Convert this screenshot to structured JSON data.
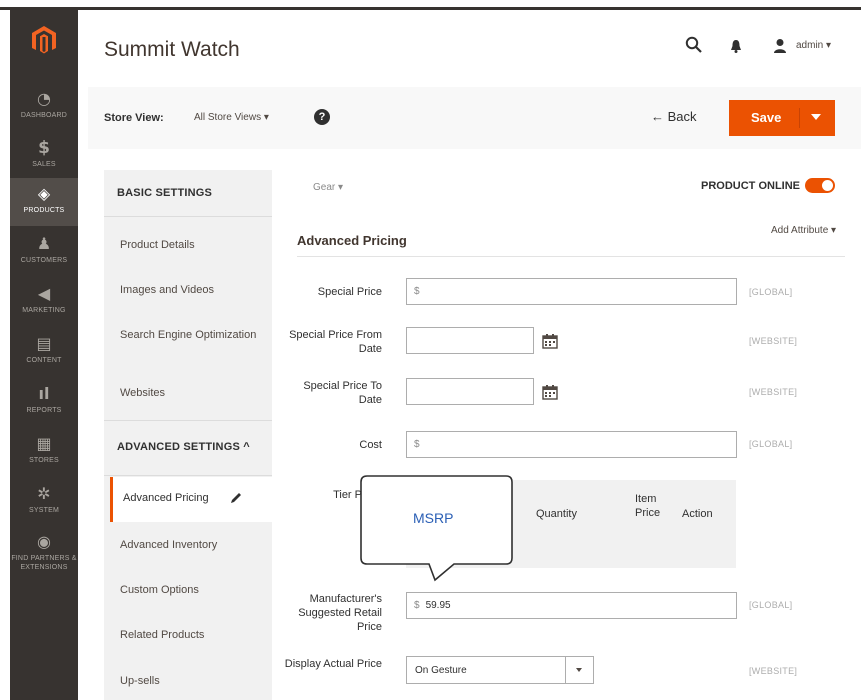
{
  "nav": {
    "items": [
      {
        "label": "DASHBOARD",
        "icon": "dashboard-icon"
      },
      {
        "label": "SALES",
        "icon": "dollar-icon"
      },
      {
        "label": "PRODUCTS",
        "icon": "cube-icon"
      },
      {
        "label": "CUSTOMERS",
        "icon": "person-icon"
      },
      {
        "label": "MARKETING",
        "icon": "megaphone-icon"
      },
      {
        "label": "CONTENT",
        "icon": "layout-icon"
      },
      {
        "label": "REPORTS",
        "icon": "bar-chart-icon"
      },
      {
        "label": "STORES",
        "icon": "store-icon"
      },
      {
        "label": "SYSTEM",
        "icon": "gear-icon"
      },
      {
        "label": "FIND PARTNERS & EXTENSIONS",
        "icon": "partners-icon"
      }
    ],
    "active": "PRODUCTS"
  },
  "header": {
    "title": "Summit Watch",
    "user": "admin ▾"
  },
  "storebar": {
    "label": "Store View:",
    "value": "All Store Views ▾",
    "help": "?",
    "back": "← Back",
    "save": "Save"
  },
  "side": {
    "basic_heading": "BASIC SETTINGS",
    "basic_items": [
      "Product Details",
      "Images and Videos",
      "Search Engine Optimization",
      "Websites"
    ],
    "advanced_heading": "ADVANCED SETTINGS  ^",
    "active_item": "Advanced Pricing",
    "advanced_items": [
      "Advanced Inventory",
      "Custom Options",
      "Related Products",
      "Up-sells"
    ]
  },
  "content": {
    "breadcrumb": "Gear ▾",
    "online_label": "PRODUCT ONLINE",
    "online": true,
    "section_title": "Advanced Pricing",
    "add_attribute": "Add Attribute ▾",
    "fields": {
      "special_price": {
        "label": "Special Price",
        "value": "$",
        "scope": "[GLOBAL]"
      },
      "special_from": {
        "label": "Special Price From Date",
        "value": "",
        "scope": "[WEBSITE]"
      },
      "special_to": {
        "label": "Special Price To Date",
        "value": "",
        "scope": "[WEBSITE]"
      },
      "cost": {
        "label": "Cost",
        "value": "$",
        "scope": "[GLOBAL]"
      },
      "tier": {
        "label": "Tier P",
        "col_quantity": "Quantity",
        "col_price": "Item Price",
        "col_action": "Action"
      },
      "msrp": {
        "label": "Manufacturer's Suggested Retail Price",
        "currency": "$",
        "value": "59.95",
        "scope": "[GLOBAL]"
      },
      "display_actual": {
        "label": "Display Actual Price",
        "value": "On Gesture",
        "scope": "[WEBSITE]"
      }
    },
    "callout": "MSRP"
  }
}
